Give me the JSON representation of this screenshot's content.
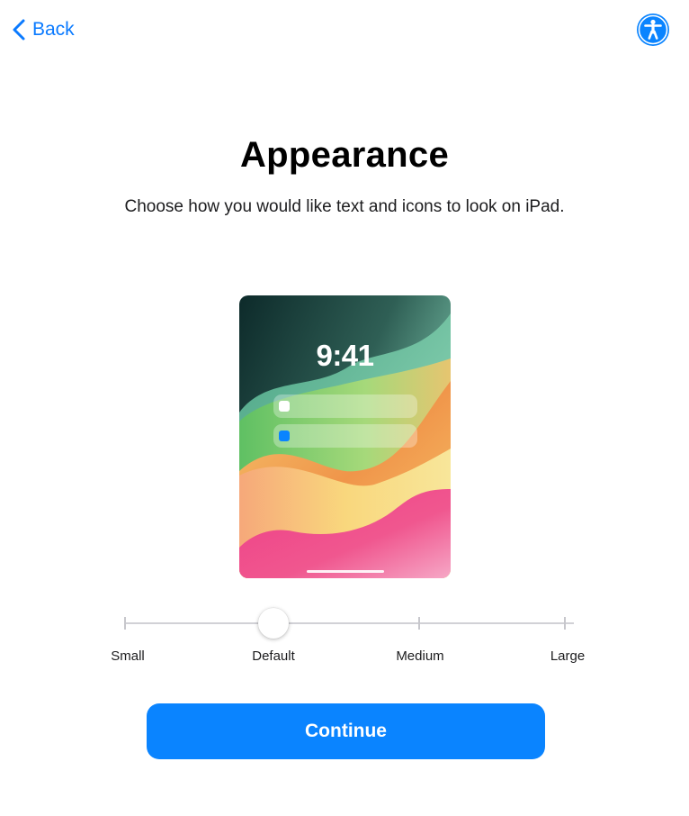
{
  "nav": {
    "back_label": "Back",
    "back_icon": "chevron-left-icon",
    "accessibility_icon": "accessibility-icon"
  },
  "page": {
    "title": "Appearance",
    "subtitle": "Choose how you would like text and icons to look on iPad."
  },
  "preview": {
    "time": "9:41",
    "notifications": [
      {
        "dot_color": "#ffffff"
      },
      {
        "dot_color": "#0a84ff"
      }
    ]
  },
  "size_slider": {
    "options": [
      "Small",
      "Default",
      "Medium",
      "Large"
    ],
    "selected": "Default",
    "selected_index": 1
  },
  "continue_label": "Continue",
  "colors": {
    "accent": "#0a84ff",
    "text": "#000000"
  }
}
